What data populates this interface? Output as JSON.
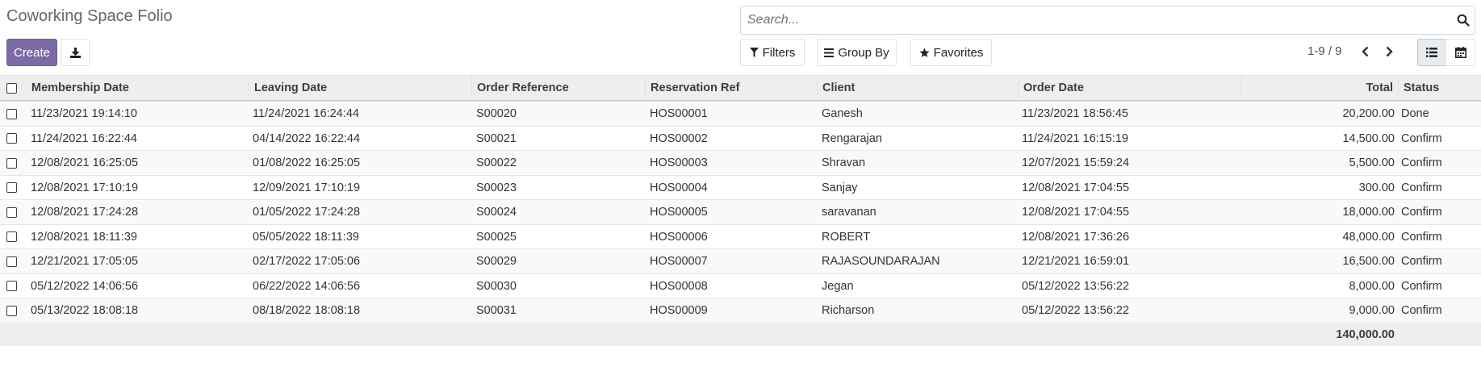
{
  "page": {
    "title": "Coworking Space Folio"
  },
  "toolbar": {
    "create_label": "Create",
    "download_icon": "download-icon",
    "filters_label": "Filters",
    "groupby_label": "Group By",
    "favorites_label": "Favorites"
  },
  "search": {
    "placeholder": "Search...",
    "value": ""
  },
  "pager": {
    "label": "1-9 / 9"
  },
  "colors": {
    "brand": "#7c6aa6",
    "header_bg": "#eeeeee"
  },
  "table": {
    "columns": [
      "Membership Date",
      "Leaving Date",
      "Order Reference",
      "Reservation Ref",
      "Client",
      "Order Date",
      "Total",
      "Status"
    ],
    "rows": [
      [
        "11/23/2021 19:14:10",
        "11/24/2021 16:24:44",
        "S00020",
        "HOS00001",
        "Ganesh",
        "11/23/2021 18:56:45",
        "20,200.00",
        "Done"
      ],
      [
        "11/24/2021 16:22:44",
        "04/14/2022 16:22:44",
        "S00021",
        "HOS00002",
        "Rengarajan",
        "11/24/2021 16:15:19",
        "14,500.00",
        "Confirm"
      ],
      [
        "12/08/2021 16:25:05",
        "01/08/2022 16:25:05",
        "S00022",
        "HOS00003",
        "Shravan",
        "12/07/2021 15:59:24",
        "5,500.00",
        "Confirm"
      ],
      [
        "12/08/2021 17:10:19",
        "12/09/2021 17:10:19",
        "S00023",
        "HOS00004",
        "Sanjay",
        "12/08/2021 17:04:55",
        "300.00",
        "Confirm"
      ],
      [
        "12/08/2021 17:24:28",
        "01/05/2022 17:24:28",
        "S00024",
        "HOS00005",
        "saravanan",
        "12/08/2021 17:04:55",
        "18,000.00",
        "Confirm"
      ],
      [
        "12/08/2021 18:11:39",
        "05/05/2022 18:11:39",
        "S00025",
        "HOS00006",
        "ROBERT",
        "12/08/2021 17:36:26",
        "48,000.00",
        "Confirm"
      ],
      [
        "12/21/2021 17:05:05",
        "02/17/2022 17:05:06",
        "S00029",
        "HOS00007",
        "RAJASOUNDARAJAN",
        "12/21/2021 16:59:01",
        "16,500.00",
        "Confirm"
      ],
      [
        "05/12/2022 14:06:56",
        "06/22/2022 14:06:56",
        "S00030",
        "HOS00008",
        "Jegan",
        "05/12/2022 13:56:22",
        "8,000.00",
        "Confirm"
      ],
      [
        "05/13/2022 18:08:18",
        "08/18/2022 18:08:18",
        "S00031",
        "HOS00009",
        "Richarson",
        "05/12/2022 13:56:22",
        "9,000.00",
        "Confirm"
      ]
    ],
    "footer_total": "140,000.00"
  }
}
